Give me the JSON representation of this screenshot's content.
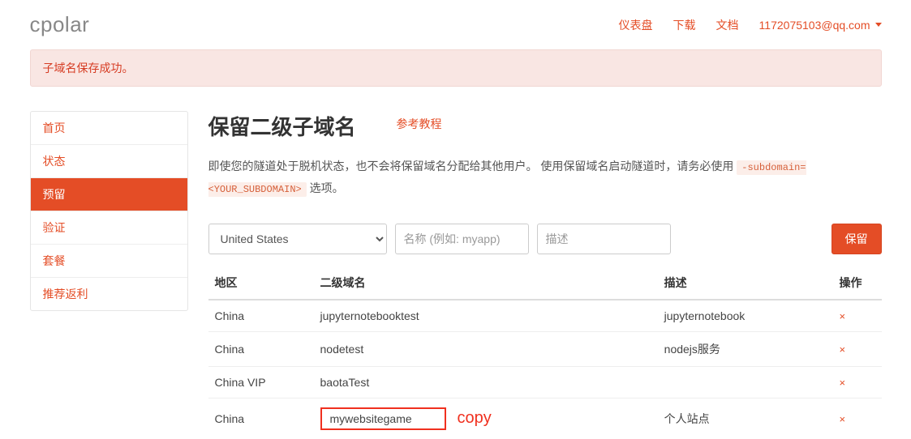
{
  "logo": "cpolar",
  "nav": {
    "dashboard": "仪表盘",
    "download": "下载",
    "docs": "文档",
    "user_email": "1172075103@qq.com"
  },
  "alert_message": "子域名保存成功。",
  "sidebar": {
    "items": [
      {
        "label": "首页",
        "active": false
      },
      {
        "label": "状态",
        "active": false
      },
      {
        "label": "预留",
        "active": true
      },
      {
        "label": "验证",
        "active": false
      },
      {
        "label": "套餐",
        "active": false
      },
      {
        "label": "推荐返利",
        "active": false
      }
    ]
  },
  "page": {
    "title": "保留二级子域名",
    "tutorial_link": "参考教程",
    "desc_part1": "即使您的隧道处于脱机状态，也不会将保留域名分配给其他用户。 使用保留域名启动隧道时，请务必使用",
    "flag_text": "-subdomain=<YOUR_SUBDOMAIN>",
    "desc_part2": "选项。"
  },
  "form": {
    "region_selected": "United States",
    "name_placeholder": "名称 (例如: myapp)",
    "desc_placeholder": "描述",
    "submit_label": "保留"
  },
  "table": {
    "headers": {
      "region": "地区",
      "subdomain": "二级域名",
      "desc": "描述",
      "action": "操作"
    },
    "rows": [
      {
        "region": "China",
        "subdomain": "jupyternotebooktest",
        "desc": "jupyternotebook"
      },
      {
        "region": "China",
        "subdomain": "nodetest",
        "desc": "nodejs服务"
      },
      {
        "region": "China VIP",
        "subdomain": "baotaTest",
        "desc": ""
      },
      {
        "region": "China",
        "subdomain": "mywebsitegame",
        "desc": "个人站点",
        "highlight": true
      }
    ]
  },
  "annotation": "copy"
}
